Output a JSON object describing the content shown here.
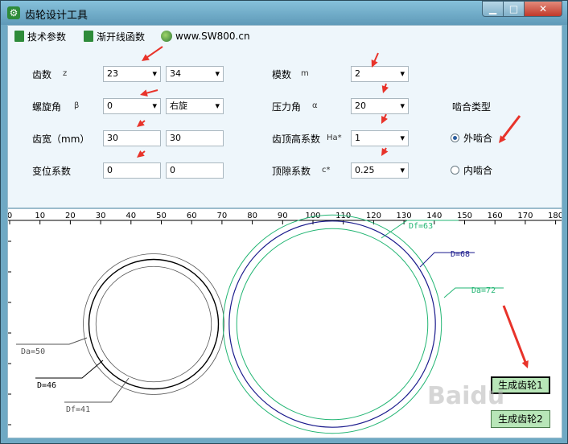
{
  "window": {
    "title": "齿轮设计工具",
    "min_icon": "minimize-icon",
    "max_icon": "maximize-icon",
    "close_icon": "close-icon",
    "min": "▁",
    "max": "□",
    "close": "✕"
  },
  "menu": {
    "items": [
      {
        "label": "技术参数",
        "icon": "document-icon"
      },
      {
        "label": "渐开线函数",
        "icon": "document-icon"
      },
      {
        "label": "www.SW800.cn",
        "icon": "globe-icon"
      }
    ]
  },
  "form": {
    "teeth": {
      "label": "齿数",
      "symbol": "z",
      "value1": "23",
      "value2": "34"
    },
    "helix": {
      "label": "螺旋角",
      "symbol": "β",
      "value1": "0",
      "value2": "右旋"
    },
    "width": {
      "label": "齿宽（mm）",
      "value1": "30",
      "value2": "30"
    },
    "shift": {
      "label": "变位系数",
      "value1": "0",
      "value2": "0"
    },
    "module": {
      "label": "模数",
      "symbol": "m",
      "value": "2"
    },
    "pressure": {
      "label": "压力角",
      "symbol": "α",
      "value": "20"
    },
    "addendum": {
      "label": "齿顶高系数",
      "symbol": "Ha*",
      "value": "1"
    },
    "clearance": {
      "label": "顶隙系数",
      "symbol": "c*",
      "value": "0.25"
    },
    "mesh_type": {
      "label": "啮合类型",
      "options": [
        "外啮合",
        "内啮合"
      ],
      "selected": "外啮合"
    }
  },
  "ruler": {
    "ticks": [
      "0",
      "10",
      "20",
      "30",
      "40",
      "50",
      "60",
      "70",
      "80",
      "90",
      "100",
      "110",
      "120",
      "130",
      "140",
      "150",
      "160",
      "170",
      "180"
    ]
  },
  "gear1": {
    "labels": {
      "da": "Da=50",
      "d": "D=46",
      "df": "Df=41"
    },
    "da": 50,
    "d": 46,
    "df": 41
  },
  "gear2": {
    "labels": {
      "df": "Df=63",
      "d": "D=68",
      "da": "Da=72"
    },
    "da": 72,
    "d": 68,
    "df": 63
  },
  "buttons": {
    "gen1": "生成齿轮1",
    "gen2": "生成齿轮2"
  },
  "watermark": "Baidu",
  "colors": {
    "green": "#22b573",
    "blue": "#1a1a8c",
    "gray": "#555555",
    "black": "#000000",
    "red": "#e8332a"
  }
}
